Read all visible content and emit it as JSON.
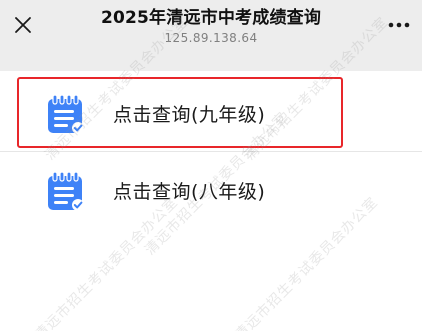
{
  "header": {
    "title": "2025年清远市中考成绩查询",
    "subtitle": "125.89.138.64",
    "close_icon": "close-icon",
    "more_icon": "more-icon"
  },
  "menu": {
    "items": [
      {
        "label": "点击查询(九年级)",
        "icon": "clipboard-icon",
        "highlighted": true
      },
      {
        "label": "点击查询(八年级)",
        "icon": "clipboard-icon",
        "highlighted": false
      }
    ]
  },
  "watermark": {
    "lines": [
      "清远市招生考试委员会办公室",
      "清远市招生考试委员会办公室",
      "清远市招生考试委员会办公室",
      "清远市招生考试委员会办公室",
      "清远市招生考试委员会办公室"
    ]
  },
  "colors": {
    "background": "#ededed",
    "card": "#ffffff",
    "icon_blue": "#3e82f7",
    "highlight_border": "#e8262a",
    "title_text": "#111111",
    "subtitle_text": "#808080"
  }
}
